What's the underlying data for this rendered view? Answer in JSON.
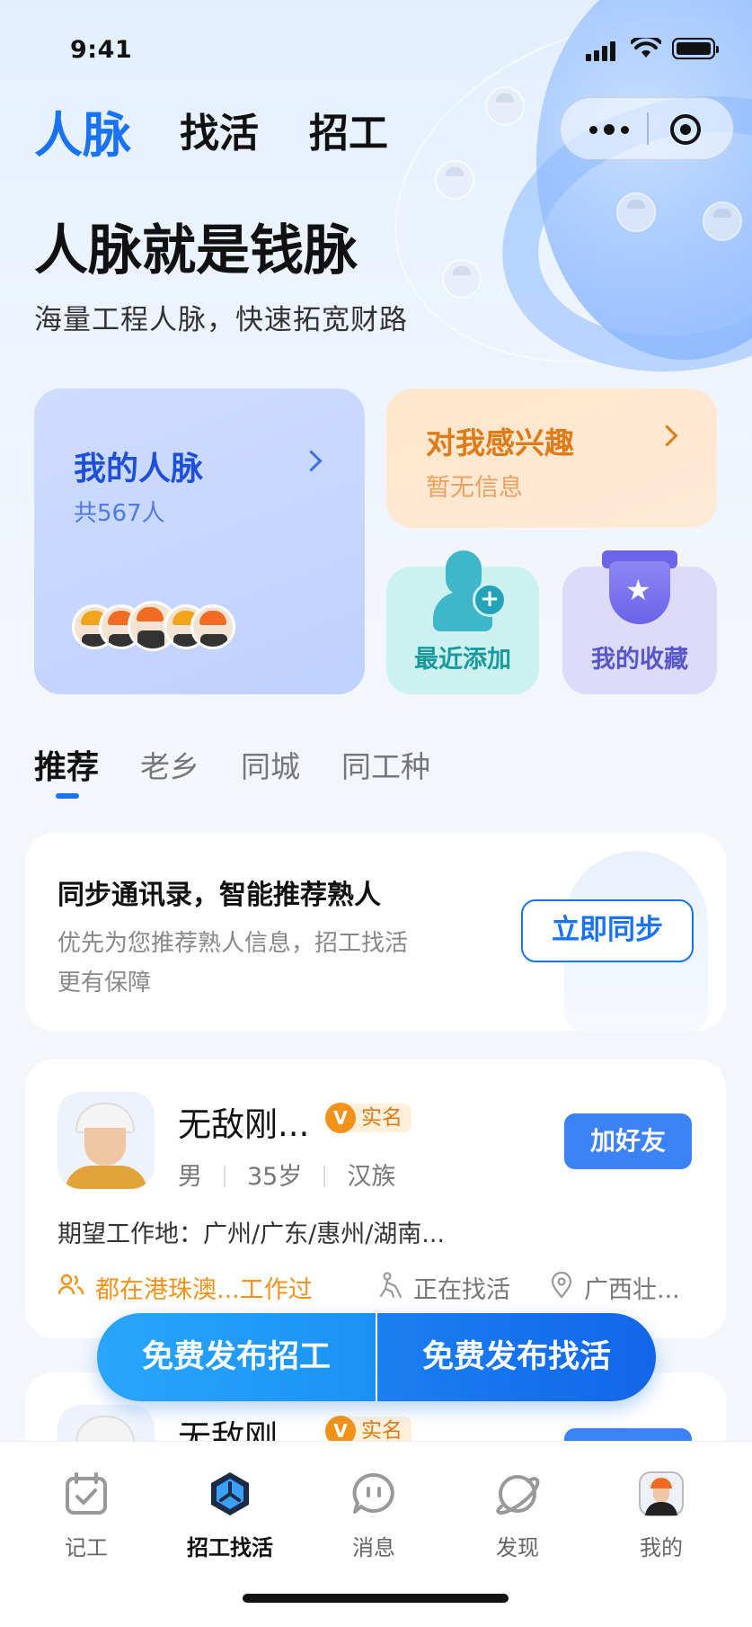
{
  "status_bar": {
    "time": "9:41"
  },
  "top_tabs": [
    {
      "label": "人脉",
      "active": true
    },
    {
      "label": "找活",
      "active": false
    },
    {
      "label": "招工",
      "active": false
    }
  ],
  "hero": {
    "title": "人脉就是钱脉",
    "subtitle": "海量工程人脉，快速拓宽财路"
  },
  "cards": {
    "my_network": {
      "title": "我的人脉",
      "count": "共567人"
    },
    "interested": {
      "title": "对我感兴趣",
      "subtitle": "暂无信息"
    },
    "recent": {
      "label": "最近添加"
    },
    "favorites": {
      "label": "我的收藏"
    }
  },
  "filter_tabs": [
    {
      "label": "推荐",
      "active": true
    },
    {
      "label": "老乡",
      "active": false
    },
    {
      "label": "同城",
      "active": false
    },
    {
      "label": "同工种",
      "active": false
    }
  ],
  "sync": {
    "title": "同步通讯录，智能推荐熟人",
    "desc_line1": "优先为您推荐熟人信息，招工找活",
    "desc_line2": "更有保障",
    "button": "立即同步"
  },
  "people": [
    {
      "name": "无敌刚...",
      "badge": "实名",
      "gender": "男",
      "age": "35岁",
      "ethnicity": "汉族",
      "add_button": "加好友",
      "location": "期望工作地：广州/广东/惠州/湖南...",
      "worked_in": "都在港珠澳...工作过",
      "status": "正在找活",
      "region": "广西壮..."
    },
    {
      "name": "无敌刚...",
      "badge": "实名"
    }
  ],
  "float_actions": {
    "left": "免费发布招工",
    "right": "免费发布找活"
  },
  "tabbar": [
    {
      "label": "记工",
      "icon": "calendar-check-icon",
      "active": false
    },
    {
      "label": "招工找活",
      "icon": "hexagon-logo-icon",
      "active": true
    },
    {
      "label": "消息",
      "icon": "chat-bubble-icon",
      "active": false
    },
    {
      "label": "发现",
      "icon": "planet-icon",
      "active": false
    },
    {
      "label": "我的",
      "icon": "user-avatar-icon",
      "active": false
    }
  ],
  "colors": {
    "primary": "#1a73f5",
    "orange": "#e07a16",
    "teal": "#1a9a9c",
    "purple": "#5856c9"
  }
}
